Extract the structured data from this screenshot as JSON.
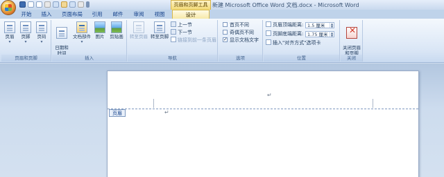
{
  "title_bar": {
    "contextual_tab_title": "页眉和页脚工具",
    "window_title": "新建 Microsoft Office Word 文档.docx - Microsoft Word"
  },
  "tabs": [
    "开始",
    "插入",
    "页面布局",
    "引用",
    "邮件",
    "审阅",
    "视图"
  ],
  "design_tab": "设计",
  "groups": {
    "header_footer": {
      "label": "页眉和页脚",
      "buttons": [
        "页眉",
        "页脚",
        "页码"
      ]
    },
    "insert": {
      "label": "插入",
      "buttons": [
        "日期和\n时间",
        "文档部件",
        "图片",
        "剪贴画"
      ]
    },
    "navigation": {
      "label": "导航",
      "goto_header": "转至页眉",
      "goto_footer": "转至页脚",
      "prev": "上一节",
      "next": "下一节",
      "link_prev": "链接到前一条页眉"
    },
    "options": {
      "label": "选项",
      "first_page": "首页不同",
      "odd_even": "奇偶页不同",
      "show_text": "显示文档文字",
      "show_text_checked": true
    },
    "position": {
      "label": "位置",
      "header_top": "页眉顶端距离:",
      "header_top_value": "1.5 厘米",
      "footer_bottom": "页脚底端距离:",
      "footer_bottom_value": "1.75 厘米",
      "insert_align_tab": "插入\"对齐方式\"选项卡"
    },
    "close": {
      "label": "关闭",
      "close_button": "关闭页眉\n和页脚"
    }
  },
  "document": {
    "header_tag": "页眉",
    "paragraph_mark": "↵"
  }
}
